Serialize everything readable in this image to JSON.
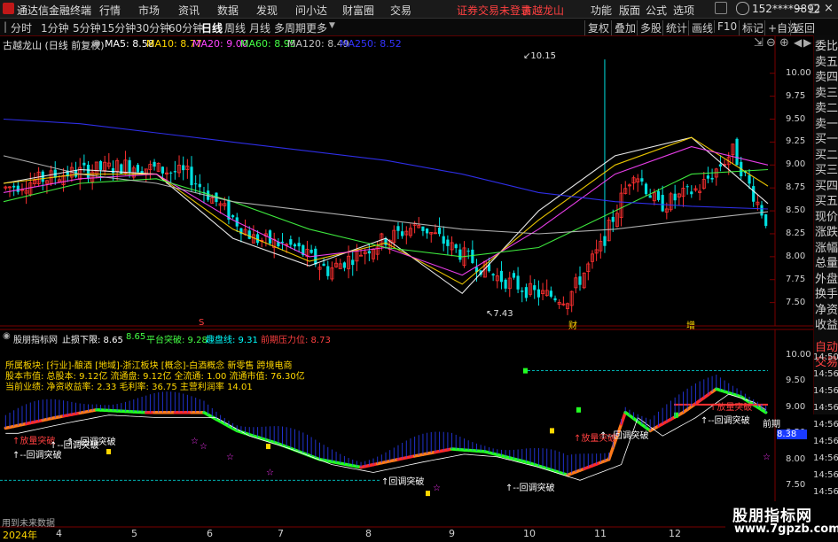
{
  "titlebar": {
    "app_name": "通达信金融终端",
    "menus": [
      "行情",
      "市场",
      "资讯",
      "数据",
      "发现",
      "问小达",
      "财富圈",
      "交易"
    ],
    "warning": "证券交易未登录",
    "stock_title": "古越龙山",
    "right_items": [
      "功能",
      "版面",
      "公式",
      "选项"
    ],
    "account": "152****9892",
    "win_buttons": [
      "—",
      "□",
      "×"
    ]
  },
  "toolbar": {
    "periods": [
      "分时",
      "1分钟",
      "5分钟",
      "15分钟",
      "30分钟",
      "60分钟",
      "日线",
      "周线",
      "月线",
      "多周期",
      "更多"
    ],
    "active_period": "日线",
    "right_tools": [
      "复权",
      "叠加",
      "多股",
      "统计",
      "画线",
      "F10",
      "标记",
      "+自选",
      "返回"
    ]
  },
  "main_chart": {
    "title": "古越龙山 (日线 前复权)",
    "ma": [
      {
        "label": "MA5: 8.58",
        "color": "#ffffff"
      },
      {
        "label": "MA10: 8.77",
        "color": "#ffd700"
      },
      {
        "label": "MA20: 9.00",
        "color": "#ff44ff"
      },
      {
        "label": "MA60: 8.95",
        "color": "#44ff44"
      },
      {
        "label": "MA120: 8.49",
        "color": "#c0c0c0"
      },
      {
        "label": "MA250: 8.52",
        "color": "#3333ff"
      }
    ],
    "y_ticks": [
      "10.00",
      "9.75",
      "9.50",
      "9.25",
      "9.00",
      "8.75",
      "8.50",
      "8.25",
      "8.00",
      "7.75",
      "7.50"
    ],
    "high_label": "10.15",
    "low_label": "7.43",
    "markers": [
      "S",
      "财",
      "增"
    ]
  },
  "sidepanel": {
    "items": [
      "委比",
      "卖五",
      "卖四",
      "卖三",
      "卖二",
      "卖一",
      "买一",
      "买二",
      "买三",
      "买四",
      "买五",
      "现价",
      "涨跌",
      "涨幅",
      "总量",
      "外盘",
      "换手",
      "净资",
      "收益"
    ],
    "lower_items": [
      "自动",
      "交易"
    ]
  },
  "indicator": {
    "name": "股朋指标网",
    "values": [
      {
        "label": "止损下限: 8.65",
        "color": "#ffffff"
      },
      {
        "label": "8.65",
        "color": "#44ff44"
      },
      {
        "label": "平台突破: 9.28",
        "color": "#44ff44"
      },
      {
        "label": "趣盘线: 9.31",
        "color": "#00ffff"
      },
      {
        "label": "前期压力位: 8.73",
        "color": "#ff4040"
      }
    ],
    "info_lines": [
      "所属板块: [行业]-酿酒 [地域]-浙江板块 [概念]-白酒概念 新零售 跨境电商",
      "股本市值: 总股本: 9.12亿 流通盘: 9.12亿 全流通: 1.00 流通市值: 76.30亿",
      "当前业绩: 净资收益率: 2.33 毛利率: 36.75 主营利润率 14.01"
    ],
    "y_ticks": [
      "10.00",
      "9.50",
      "9.00",
      "8.50",
      "8.00",
      "7.50"
    ],
    "right_ticks": [
      "14:50",
      "14:56",
      "14:56",
      "14:56",
      "14:56",
      "14:56",
      "14:56",
      "14:56",
      "14:56",
      "14:56"
    ],
    "current_value": "8.38",
    "annotations": [
      "↑放量突破",
      "↑--回调突破",
      "↑--回调突破",
      "↑--回调突破",
      "↑放量突破",
      "↑--回调突破",
      "前期",
      "↑回调突破",
      "↑--回调突破"
    ]
  },
  "bottom": {
    "hint": "用到未来数据",
    "x_labels": [
      "2024年",
      "4",
      "5",
      "6",
      "7",
      "8",
      "9",
      "10",
      "11",
      "12"
    ],
    "watermark_text": "股朋指标网",
    "watermark_url": "www.7gpzb.com"
  },
  "chart_data": {
    "type": "line",
    "title": "古越龙山 (日线 前复权)",
    "xlabel": "",
    "ylabel": "",
    "ylim": [
      7.4,
      10.2
    ],
    "x": [
      "2024年",
      "4",
      "5",
      "6",
      "7",
      "8",
      "9",
      "10",
      "11",
      "12"
    ],
    "series": [
      {
        "name": "MA5",
        "values": [
          8.8,
          8.95,
          8.9,
          8.2,
          7.9,
          8.2,
          7.6,
          8.5,
          9.1,
          9.3,
          8.58
        ]
      },
      {
        "name": "MA10",
        "values": [
          8.8,
          8.9,
          8.9,
          8.3,
          7.95,
          8.15,
          7.7,
          8.4,
          9.0,
          9.3,
          8.77
        ]
      },
      {
        "name": "MA20",
        "values": [
          8.7,
          8.85,
          8.9,
          8.4,
          8.0,
          8.1,
          7.8,
          8.3,
          8.9,
          9.2,
          9.0
        ]
      },
      {
        "name": "MA60",
        "values": [
          8.6,
          8.8,
          8.85,
          8.6,
          8.3,
          8.1,
          8.0,
          8.1,
          8.5,
          8.9,
          8.95
        ]
      },
      {
        "name": "MA120",
        "values": [
          9.1,
          8.9,
          8.8,
          8.6,
          8.5,
          8.4,
          8.3,
          8.25,
          8.3,
          8.4,
          8.49
        ]
      },
      {
        "name": "MA250",
        "values": [
          9.5,
          9.45,
          9.35,
          9.25,
          9.15,
          9.05,
          8.9,
          8.7,
          8.6,
          8.55,
          8.52
        ]
      }
    ],
    "annotations": [
      "10.15",
      "7.43"
    ]
  }
}
